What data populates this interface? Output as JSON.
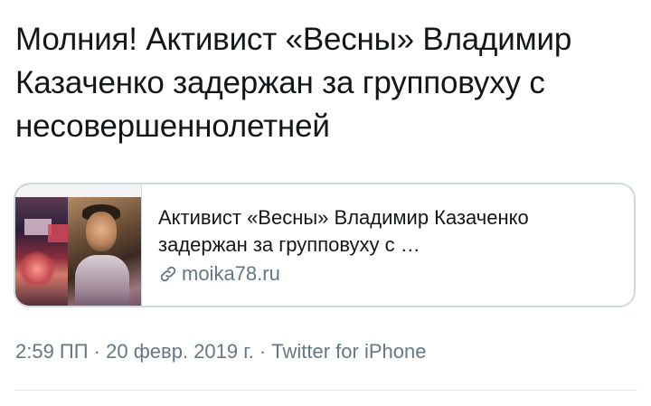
{
  "tweet": {
    "text_line1": "Молния! Активист «Весны» Владимир",
    "text_line2": "Казаченко задержан за групповуху с",
    "text_line3": "несовершеннолетней"
  },
  "card": {
    "title_line1": "Активист «Весны» Владимир Казаченко",
    "title_line2": "задержан за групповуху с …",
    "domain": "moika78.ru",
    "link_icon": "link-icon"
  },
  "meta": {
    "time": "2:59 ПП",
    "separator1": " · ",
    "date": "20 февр. 2019 г.",
    "separator2": " · ",
    "source": "Twitter for iPhone"
  },
  "colors": {
    "text": "#14171a",
    "secondary": "#657786",
    "border": "#cfd9de"
  }
}
